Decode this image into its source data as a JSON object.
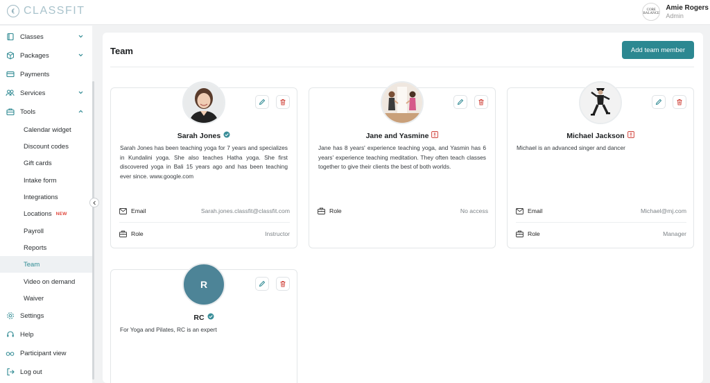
{
  "app": {
    "logo_text": "CLASSFIT"
  },
  "user": {
    "name": "Amie Rogers",
    "role": "Admin",
    "avatar_text": "CORE BALANCE"
  },
  "sidebar": {
    "items": [
      {
        "label": "Classes"
      },
      {
        "label": "Packages"
      },
      {
        "label": "Payments"
      },
      {
        "label": "Services"
      },
      {
        "label": "Tools"
      }
    ],
    "tools_sub": [
      {
        "label": "Calendar widget"
      },
      {
        "label": "Discount codes"
      },
      {
        "label": "Gift cards"
      },
      {
        "label": "Intake form"
      },
      {
        "label": "Integrations"
      },
      {
        "label": "Locations",
        "badge": "NEW"
      },
      {
        "label": "Payroll"
      },
      {
        "label": "Reports"
      },
      {
        "label": "Team"
      },
      {
        "label": "Video on demand"
      },
      {
        "label": "Waiver"
      }
    ],
    "bottom": [
      {
        "label": "Settings"
      },
      {
        "label": "Help"
      },
      {
        "label": "Participant view"
      },
      {
        "label": "Log out"
      }
    ]
  },
  "page": {
    "title": "Team",
    "add_button": "Add team member"
  },
  "team": [
    {
      "name": "Sarah Jones",
      "status": "verified",
      "bio": "Sarah Jones has been teaching yoga for 7 years and specializes in Kundalini yoga. She also teaches Hatha yoga. She first discovered yoga in Bali 15 years ago and has been teaching ever since. www.google.com",
      "email_label": "Email",
      "email": "Sarah.jones.classfit@classfit.com",
      "role_label": "Role",
      "role": "Instructor"
    },
    {
      "name": "Jane and Yasmine",
      "status": "warning",
      "bio": "Jane has 8 years' experience teaching yoga, and Yasmin has 6 years' experience teaching meditation. They often teach classes together to give their clients the best of both worlds.",
      "role_label": "Role",
      "role": "No access"
    },
    {
      "name": "Michael Jackson",
      "status": "warning",
      "bio": "Michael is an advanced singer and dancer",
      "email_label": "Email",
      "email": "Michael@mj.com",
      "role_label": "Role",
      "role": "Manager"
    },
    {
      "name": "RC",
      "initials": "R",
      "status": "verified",
      "bio": "For Yoga and Pilates, RC is an expert"
    }
  ],
  "colors": {
    "accent": "#2c8891",
    "verified": "#3a8e99",
    "warning": "#d0473f",
    "new_badge": "#e0453a",
    "avatar_bg": "#4d8497"
  }
}
